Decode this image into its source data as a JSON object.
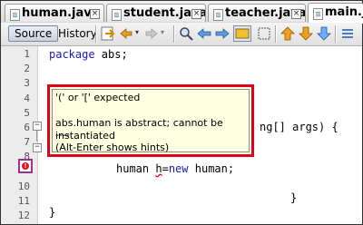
{
  "tabs": [
    {
      "label": "human.java"
    },
    {
      "label": "student.java"
    },
    {
      "label": "teacher.java"
    },
    {
      "label": "main.java"
    }
  ],
  "toolbar": {
    "source_label": "Source",
    "history_label": "History"
  },
  "editor": {
    "line_numbers": [
      "1",
      "2",
      "3",
      "4",
      "5",
      "6",
      "7",
      "8",
      "9",
      "10",
      "11",
      "12"
    ],
    "line1_keyword": "package",
    "line1_rest": " abs;",
    "line6_visible": "ng[] args) {",
    "line9_text": "human ",
    "line9_var": "h",
    "line9_eq": "=",
    "line9_new": "new",
    "line9_rest": " human;",
    "line11_brace": "}",
    "line12_brace": "}"
  },
  "tooltip": {
    "line1": "'(' or '[' expected",
    "line2": "abs.human is abstract; cannot be instantiated",
    "line3": "----",
    "line4": "(Alt-Enter shows hints)"
  },
  "colors": {
    "keyword": "#1a1ab8",
    "error_border": "#e0001b",
    "tooltip_bg": "#ffffe1"
  }
}
